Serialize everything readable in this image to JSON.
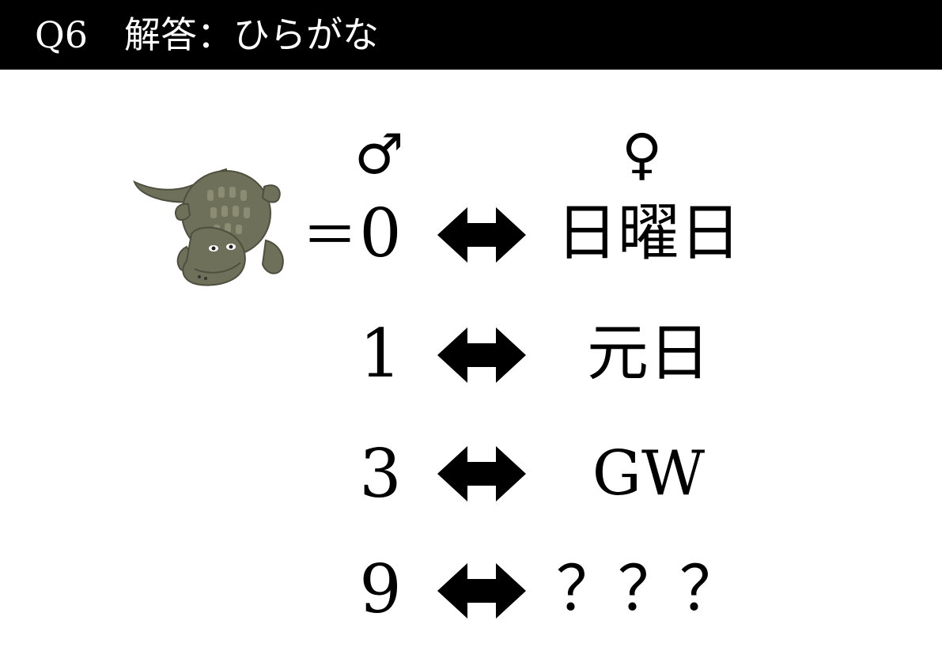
{
  "header": {
    "title": "Q6　解答：ひらがな",
    "background": "#000000",
    "text_color": "#ffffff"
  },
  "symbols": {
    "male": "♂",
    "female": "♀"
  },
  "equals": "＝",
  "illustration": {
    "icon": "crocodile-icon",
    "colors": [
      "#6f705a",
      "#8b8c72",
      "#4e4f3e"
    ]
  },
  "rows": [
    {
      "number": "0",
      "answer": "日曜日"
    },
    {
      "number": "1",
      "answer": "元日"
    },
    {
      "number": "3",
      "answer": "GW"
    },
    {
      "number": "9",
      "answer": "？？？"
    }
  ],
  "arrow_icon": "double-arrow-icon"
}
